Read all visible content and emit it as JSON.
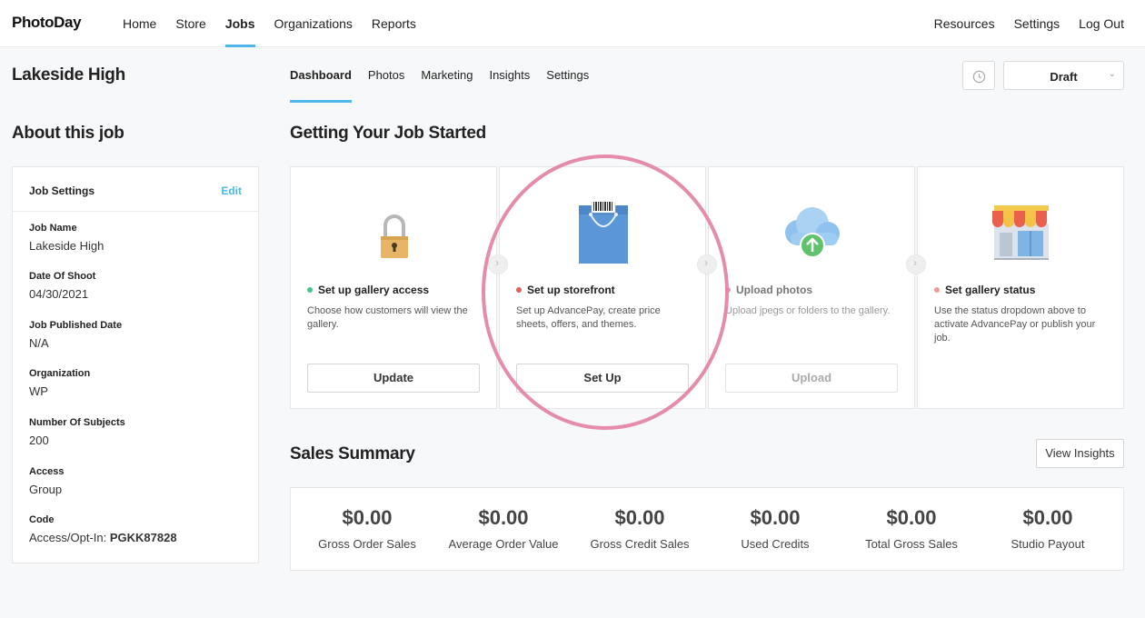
{
  "nav": {
    "logo": "PhotoDay",
    "left": [
      "Home",
      "Store",
      "Jobs",
      "Organizations",
      "Reports"
    ],
    "active": "Jobs",
    "right": [
      "Resources",
      "Settings",
      "Log Out"
    ]
  },
  "job": {
    "title": "Lakeside High",
    "about_title": "About this job"
  },
  "settings_card": {
    "heading": "Job Settings",
    "edit_label": "Edit",
    "fields": [
      {
        "label": "Job Name",
        "value": "Lakeside High"
      },
      {
        "label": "Date Of Shoot",
        "value": "04/30/2021"
      },
      {
        "label": "Job Published Date",
        "value": "N/A"
      },
      {
        "label": "Organization",
        "value": "WP"
      },
      {
        "label": "Number Of Subjects",
        "value": "200"
      },
      {
        "label": "Access",
        "value": "Group"
      },
      {
        "label": "Code",
        "value_prefix": "Access/Opt-In: ",
        "value_code": "PGKK87828"
      }
    ]
  },
  "tabs": [
    "Dashboard",
    "Photos",
    "Marketing",
    "Insights",
    "Settings"
  ],
  "active_tab": "Dashboard",
  "status": {
    "value": "Draft",
    "icon": "history-icon"
  },
  "getting_started": {
    "title": "Getting Your Job Started",
    "steps": [
      {
        "title": "Set up gallery access",
        "desc": "Choose how customers will view the gallery.",
        "button": "Update",
        "dot_color": "#4cc38a",
        "icon": "padlock-icon"
      },
      {
        "title": "Set up storefront",
        "desc": "Set up AdvancePay, create price sheets, offers, and themes.",
        "button": "Set Up",
        "dot_color": "#e0625a",
        "icon": "shopping-bag-icon"
      },
      {
        "title": "Upload photos",
        "desc": "Upload jpegs or folders to the gallery.",
        "button": "Upload",
        "dot_color": "#e88fb0",
        "icon": "cloud-upload-icon"
      },
      {
        "title": "Set gallery status",
        "desc": "Use the status dropdown above to activate AdvancePay or publish your job.",
        "button": "",
        "dot_color": "#ef9a9a",
        "icon": "storefront-icon"
      }
    ]
  },
  "sales": {
    "title": "Sales Summary",
    "view_insights": "View Insights",
    "metrics": [
      {
        "value": "$0.00",
        "label": "Gross Order Sales"
      },
      {
        "value": "$0.00",
        "label": "Average Order Value"
      },
      {
        "value": "$0.00",
        "label": "Gross Credit Sales"
      },
      {
        "value": "$0.00",
        "label": "Used Credits"
      },
      {
        "value": "$0.00",
        "label": "Total Gross Sales"
      },
      {
        "value": "$0.00",
        "label": "Studio Payout"
      }
    ]
  },
  "colors": {
    "accent": "#4fb7ec",
    "highlight": "#e486a8"
  }
}
